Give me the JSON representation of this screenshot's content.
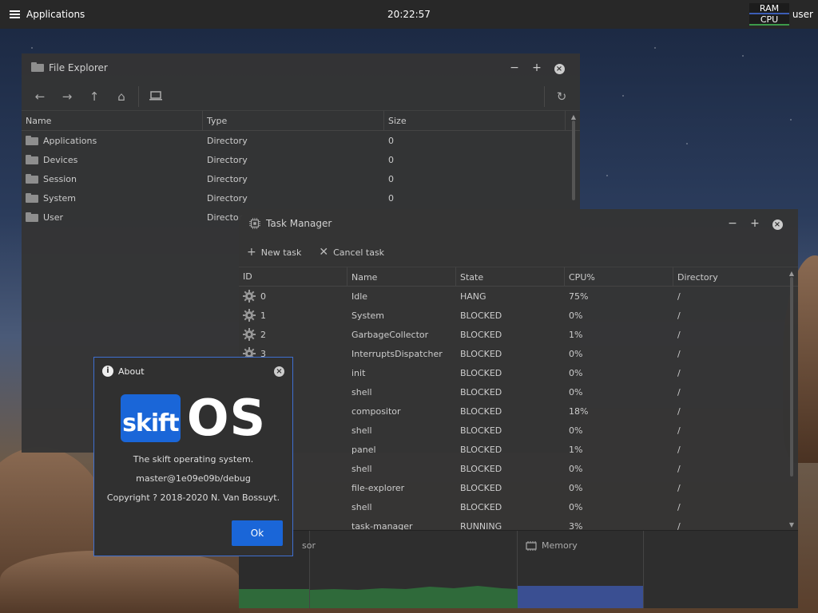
{
  "panel": {
    "menu_label": "Applications",
    "clock": "20:22:57",
    "ram_label": "RAM",
    "cpu_label": "CPU",
    "user": "user",
    "ram_color": "#3c5db5",
    "cpu_color": "#3c9a4a"
  },
  "file_explorer": {
    "title": "File Explorer",
    "columns": [
      "Name",
      "Type",
      "Size"
    ],
    "rows": [
      {
        "name": "Applications",
        "type": "Directory",
        "size": "0"
      },
      {
        "name": "Devices",
        "type": "Directory",
        "size": "0"
      },
      {
        "name": "Session",
        "type": "Directory",
        "size": "0"
      },
      {
        "name": "System",
        "type": "Directory",
        "size": "0"
      },
      {
        "name": "User",
        "type": "Director",
        "size": ""
      }
    ]
  },
  "task_manager": {
    "title": "Task Manager",
    "new_task": "New task",
    "cancel_task": "Cancel task",
    "columns": [
      "ID",
      "Name",
      "State",
      "CPU%",
      "Directory"
    ],
    "rows": [
      {
        "id": "0",
        "name": "Idle",
        "state": "HANG",
        "cpu": "75%",
        "dir": "/"
      },
      {
        "id": "1",
        "name": "System",
        "state": "BLOCKED",
        "cpu": "0%",
        "dir": "/"
      },
      {
        "id": "2",
        "name": "GarbageCollector",
        "state": "BLOCKED",
        "cpu": "1%",
        "dir": "/"
      },
      {
        "id": "3",
        "name": "InterruptsDispatcher",
        "state": "BLOCKED",
        "cpu": "0%",
        "dir": "/"
      },
      {
        "id": "",
        "name": "init",
        "state": "BLOCKED",
        "cpu": "0%",
        "dir": "/"
      },
      {
        "id": "",
        "name": "shell",
        "state": "BLOCKED",
        "cpu": "0%",
        "dir": "/"
      },
      {
        "id": "",
        "name": "compositor",
        "state": "BLOCKED",
        "cpu": "18%",
        "dir": "/"
      },
      {
        "id": "",
        "name": "shell",
        "state": "BLOCKED",
        "cpu": "0%",
        "dir": "/"
      },
      {
        "id": "",
        "name": "panel",
        "state": "BLOCKED",
        "cpu": "1%",
        "dir": "/"
      },
      {
        "id": "",
        "name": "shell",
        "state": "BLOCKED",
        "cpu": "0%",
        "dir": "/"
      },
      {
        "id": "",
        "name": "file-explorer",
        "state": "BLOCKED",
        "cpu": "0%",
        "dir": "/"
      },
      {
        "id": "",
        "name": "shell",
        "state": "BLOCKED",
        "cpu": "0%",
        "dir": "/"
      },
      {
        "id": "",
        "name": "task-manager",
        "state": "RUNNING",
        "cpu": "3%",
        "dir": "/"
      }
    ],
    "processor_label": "sor",
    "memory_label": "Memory",
    "processor_color": "#3c9a4a",
    "memory_color": "#3c5db5"
  },
  "about": {
    "title": "About",
    "logo_text": "skift",
    "logo_os": "OS",
    "line1": "The skift operating system.",
    "line2": "master@1e09e09b/debug",
    "line3": "Copyright ? 2018-2020 N. Van Bossuyt.",
    "ok_label": "Ok",
    "accent": "#1a66d8"
  }
}
